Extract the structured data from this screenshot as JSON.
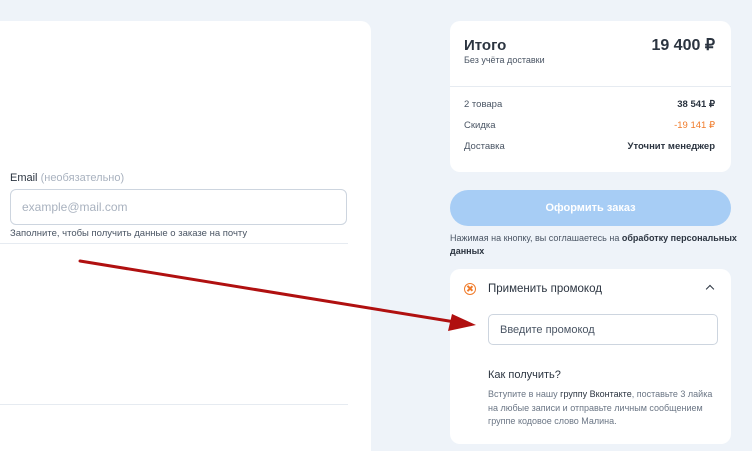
{
  "form": {
    "email_label": "Email",
    "email_optional": "(необязательно)",
    "email_placeholder": "example@mail.com",
    "email_value": "",
    "email_hint": "Заполните, чтобы получить данные о заказе на почту"
  },
  "summary": {
    "total_label": "Итого",
    "total_value": "19 400 ₽",
    "total_sub": "Без учёта доставки",
    "rows": [
      {
        "label": "2 товара",
        "value": "38 541 ₽"
      },
      {
        "label": "Скидка",
        "value": "-19 141 ₽"
      },
      {
        "label": "Доставка",
        "value": "Уточнит менеджер"
      }
    ]
  },
  "order": {
    "button_label": "Оформить заказ",
    "agree_text": "Нажимая на кнопку, вы соглашаетесь на",
    "agree_link": "обработку персональных данных"
  },
  "promo": {
    "title": "Применить промокод",
    "placeholder": "Введите промокод",
    "value": "",
    "how_title": "Как получить?",
    "how_text_1": "Вступите в нашу",
    "how_group": "группу Вконтакте",
    "how_text_2": ", поставьте 3 лайка на любые записи и отправьте личным сообщением группе кодовое слово Малина."
  },
  "colors": {
    "accent_orange": "#f07b2a",
    "button_blue": "#a7cdf5",
    "annotation_arrow": "#b01010"
  },
  "icons": {
    "promo": "close-circle-icon",
    "collapse": "chevron-up-icon",
    "annotation": "arrow-annotation-icon"
  }
}
